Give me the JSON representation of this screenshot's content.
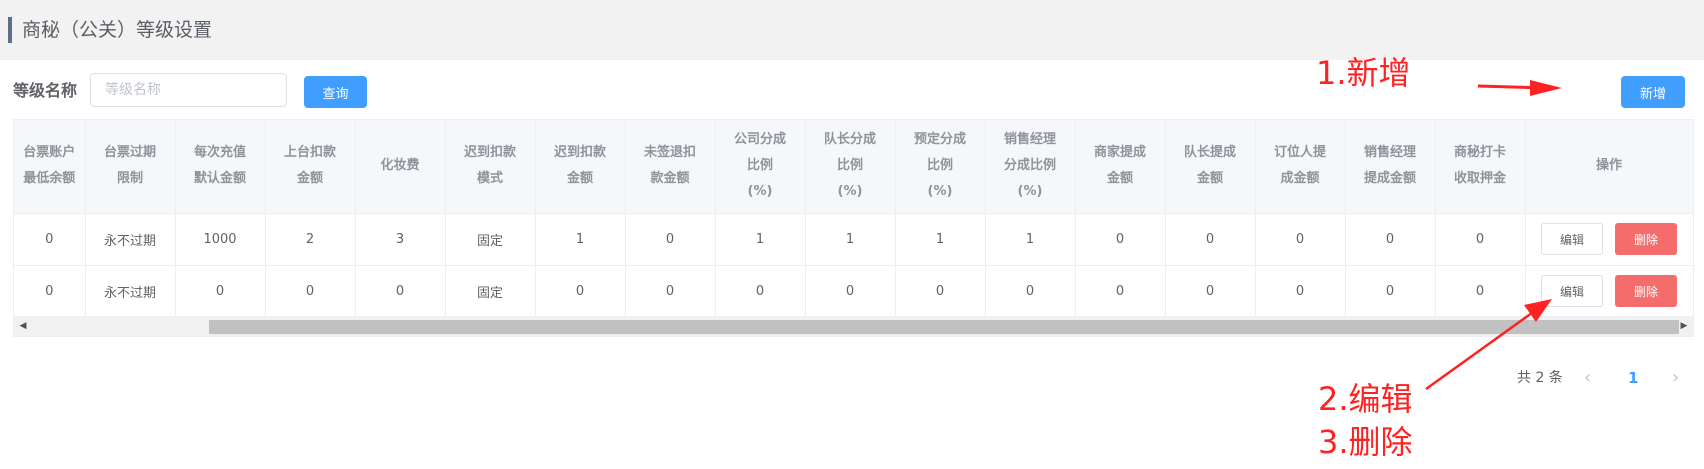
{
  "header": {
    "title": "商秘（公关）等级设置"
  },
  "filter": {
    "label": "等级名称",
    "placeholder": "等级名称",
    "value": "",
    "query_label": "查询",
    "add_label": "新增"
  },
  "annotations": {
    "add": "1.新增",
    "edit": "2.编辑",
    "delete": "3.删除"
  },
  "table": {
    "columns": [
      "台票账户\n最低余额",
      "台票过期\n限制",
      "每次充值\n默认金额",
      "上台扣款\n金额",
      "化妆费",
      "迟到扣款\n模式",
      "迟到扣款\n金额",
      "未签退扣\n款金额",
      "公司分成\n比例\n(%)",
      "队长分成\n比例\n(%)",
      "预定分成\n比例\n(%)",
      "销售经理\n分成比例\n(%)",
      "商家提成\n金额",
      "队长提成\n金额",
      "订位人提\n成金额",
      "销售经理\n提成金额",
      "商秘打卡\n收取押金",
      "操作"
    ],
    "rows": [
      [
        "0",
        "永不过期",
        "1000",
        "2",
        "3",
        "固定",
        "1",
        "0",
        "1",
        "1",
        "1",
        "1",
        "0",
        "0",
        "0",
        "0",
        "0"
      ],
      [
        "0",
        "永不过期",
        "0",
        "0",
        "0",
        "固定",
        "0",
        "0",
        "0",
        "0",
        "0",
        "0",
        "0",
        "0",
        "0",
        "0",
        "0"
      ]
    ],
    "edit_label": "编辑",
    "delete_label": "删除"
  },
  "pagination": {
    "total_text": "共 2 条",
    "current_page": "1",
    "prev_icon": "‹",
    "next_icon": "›"
  },
  "colors": {
    "primary": "#409eff",
    "danger": "#f56c6c",
    "annotation": "#ff2222"
  }
}
